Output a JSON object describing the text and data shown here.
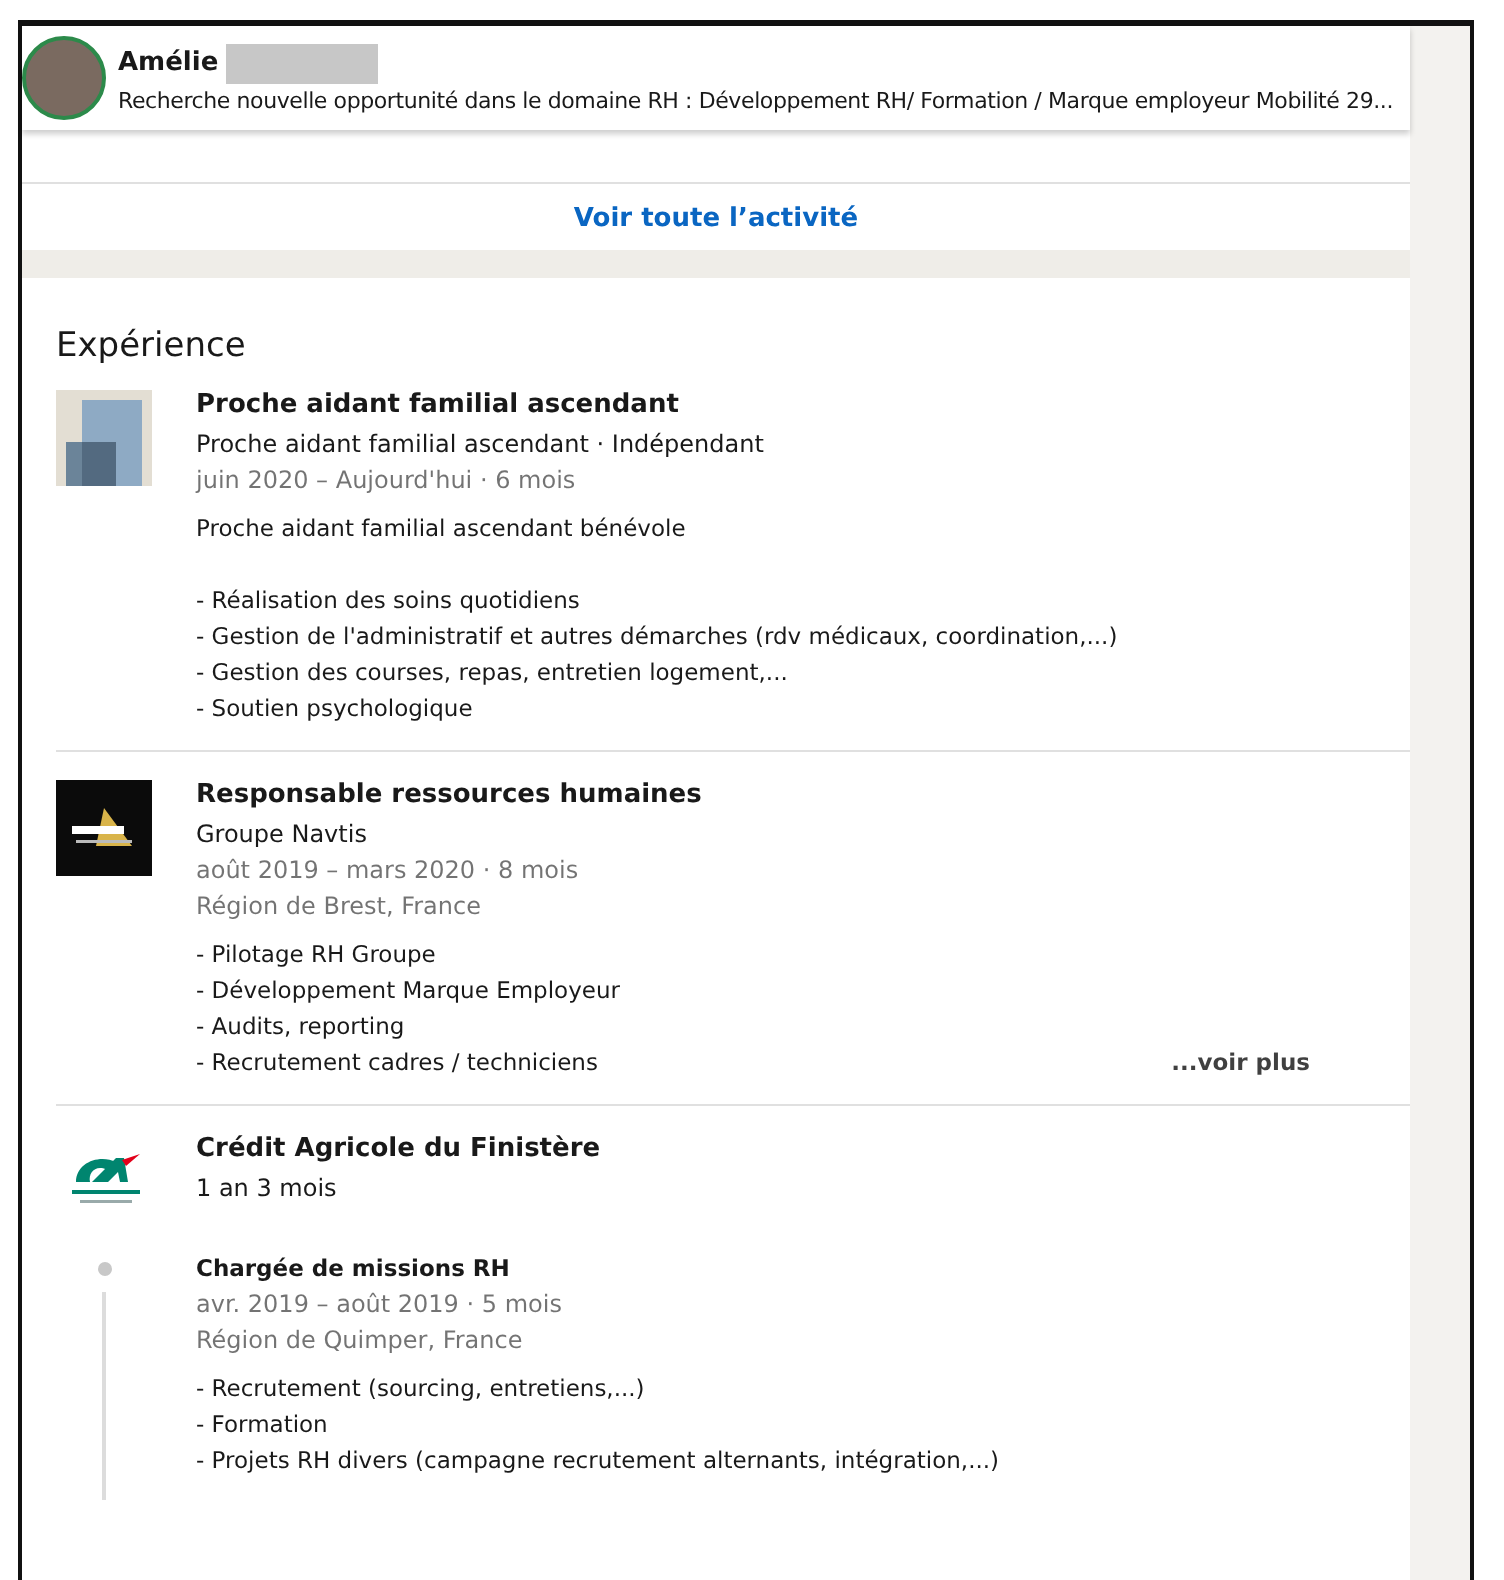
{
  "header": {
    "name": "Amélie",
    "subtitle": "Recherche nouvelle opportunité dans le domaine RH : Développement RH/ Formation / Marque employeur Mobilité 29..."
  },
  "activity": {
    "link": "Voir toute l’activité"
  },
  "experience": {
    "title": "Expérience",
    "entries": [
      {
        "kind": "single",
        "title": "Proche aidant familial ascendant",
        "company": "Proche aidant familial ascendant · Indépendant",
        "dates": "juin 2020 – Aujourd'hui · 6 mois",
        "summary": "Proche aidant familial ascendant bénévole",
        "lines": [
          "- Réalisation des soins quotidiens",
          "- Gestion de l'administratif et autres démarches (rdv médicaux, coordination,...)",
          "- Gestion des courses, repas, entretien logement,...",
          "- Soutien psychologique"
        ]
      },
      {
        "kind": "single",
        "title": "Responsable ressources humaines",
        "company": "Groupe Navtis",
        "dates": "août 2019 – mars 2020 · 8 mois",
        "location": "Région de Brest, France",
        "lines": [
          "- Pilotage RH Groupe",
          "- Développement Marque Employeur",
          "- Audits, reporting",
          "- Recrutement cadres / techniciens"
        ],
        "more": "...voir plus"
      },
      {
        "kind": "group",
        "company": "Crédit Agricole du Finistère",
        "duration": "1 an 3 mois",
        "roles": [
          {
            "title": "Chargée de missions RH",
            "dates": "avr. 2019 – août 2019 · 5 mois",
            "location": "Région de Quimper, France",
            "lines": [
              "- Recrutement (sourcing, entretiens,...)",
              "- Formation",
              "- Projets RH divers (campagne recrutement alternants, intégration,...)"
            ]
          }
        ]
      }
    ]
  }
}
